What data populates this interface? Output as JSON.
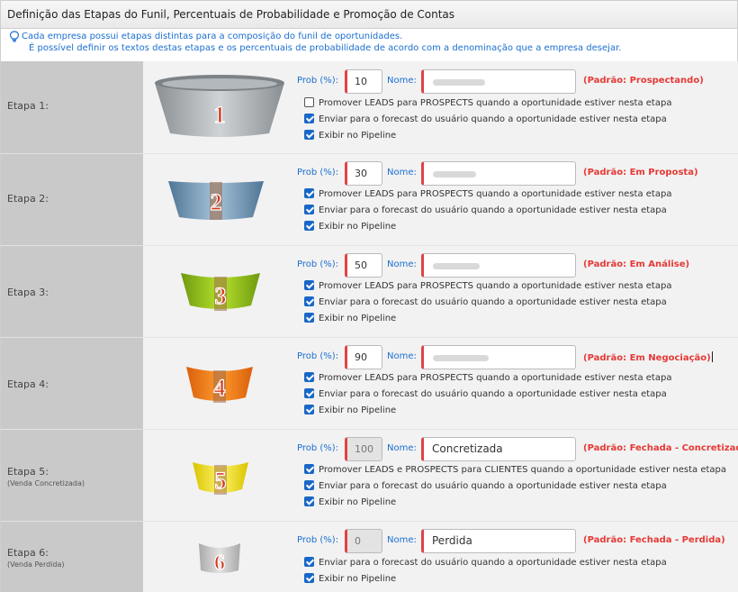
{
  "header": {
    "title": "Definição das Etapas do Funil, Percentuais de Probabilidade e Promoção de Contas"
  },
  "info": {
    "line1": "Cada empresa possui etapas distintas para a composição do funil de oportunidades.",
    "line2": "É possível definir os textos destas etapas e os percentuais de probabilidade de acordo com a denominação que a empresa desejar."
  },
  "labels": {
    "prob": "Prob (%):",
    "nome": "Nome:"
  },
  "colors": {
    "link_blue": "#1b6fd0",
    "default_red": "#e53935",
    "checkbox_blue": "#1867c7",
    "left_column": "#c9c9c9"
  },
  "stages": [
    {
      "label": "Etapa 1:",
      "sub": "",
      "number": "1",
      "prob": "10",
      "nome": "",
      "nome_blurred": true,
      "padrao": "(Padrão: Prospectando)",
      "checks": [
        {
          "text": "Promover LEADS para PROSPECTS quando a oportunidade estiver nesta etapa",
          "checked": false
        },
        {
          "text": "Enviar para o forecast do usuário quando a oportunidade estiver nesta etapa",
          "checked": true
        },
        {
          "text": "Exibir no Pipeline",
          "checked": true
        }
      ]
    },
    {
      "label": "Etapa 2:",
      "sub": "",
      "number": "2",
      "prob": "30",
      "nome": "",
      "nome_blurred": true,
      "padrao": "(Padrão: Em Proposta)",
      "checks": [
        {
          "text": "Promover LEADS para PROSPECTS quando a oportunidade estiver nesta etapa",
          "checked": true
        },
        {
          "text": "Enviar para o forecast do usuário quando a oportunidade estiver nesta etapa",
          "checked": true
        },
        {
          "text": "Exibir no Pipeline",
          "checked": true
        }
      ]
    },
    {
      "label": "Etapa 3:",
      "sub": "",
      "number": "3",
      "prob": "50",
      "nome": "",
      "nome_blurred": true,
      "padrao": "(Padrão: Em Análise)",
      "checks": [
        {
          "text": "Promover LEADS para PROSPECTS quando a oportunidade estiver nesta etapa",
          "checked": true
        },
        {
          "text": "Enviar para o forecast do usuário quando a oportunidade estiver nesta etapa",
          "checked": true
        },
        {
          "text": "Exibir no Pipeline",
          "checked": true
        }
      ]
    },
    {
      "label": "Etapa 4:",
      "sub": "",
      "number": "4",
      "prob": "90",
      "nome": "",
      "nome_blurred": true,
      "padrao": "(Padrão: Em Negociação)",
      "checks": [
        {
          "text": "Promover LEADS para PROSPECTS quando a oportunidade estiver nesta etapa",
          "checked": true
        },
        {
          "text": "Enviar para o forecast do usuário quando a oportunidade estiver nesta etapa",
          "checked": true
        },
        {
          "text": "Exibir no Pipeline",
          "checked": true
        }
      ]
    },
    {
      "label": "Etapa 5:",
      "sub": "(Venda Concretizada)",
      "number": "5",
      "prob": "100",
      "nome": "Concretizada",
      "nome_blurred": false,
      "padrao": "(Padrão: Fechada - Concretizada)",
      "checks": [
        {
          "text": "Promover LEADS e PROSPECTS para CLIENTES quando a oportunidade estiver nesta etapa",
          "checked": true
        },
        {
          "text": "Enviar para o forecast do usuário quando a oportunidade estiver nesta etapa",
          "checked": true
        },
        {
          "text": "Exibir no Pipeline",
          "checked": true
        }
      ]
    },
    {
      "label": "Etapa 6:",
      "sub": "(Venda Perdida)",
      "number": "6",
      "prob": "0",
      "nome": "Perdida",
      "nome_blurred": false,
      "padrao": "(Padrão: Fechada - Perdida)",
      "checks": [
        {
          "text": "Enviar para o forecast do usuário quando a oportunidade estiver nesta etapa",
          "checked": true
        },
        {
          "text": "Exibir no Pipeline",
          "checked": true
        }
      ]
    }
  ]
}
